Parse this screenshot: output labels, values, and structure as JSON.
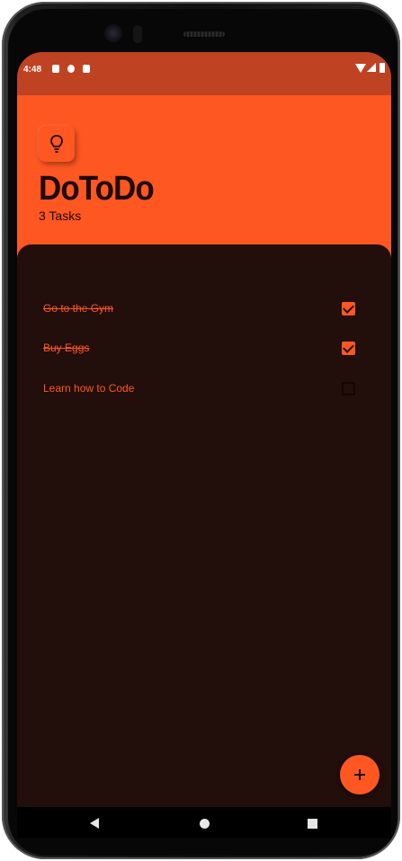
{
  "status_bar": {
    "time": "4:48"
  },
  "header": {
    "title": "DoToDo",
    "task_count": "3 Tasks",
    "icon": "lightbulb-icon"
  },
  "tasks": [
    {
      "label": "Go to the Gym",
      "done": true
    },
    {
      "label": "Buy Eggs",
      "done": true
    },
    {
      "label": "Learn how to Code",
      "done": false
    }
  ],
  "fab": {
    "icon": "plus-icon"
  },
  "nav": {
    "back": "back-icon",
    "home": "home-icon",
    "recents": "recents-icon"
  },
  "colors": {
    "accent": "#ff5722",
    "status_bar": "#bf4322",
    "background": "#220e0a",
    "text_dark": "#1d0a06"
  }
}
